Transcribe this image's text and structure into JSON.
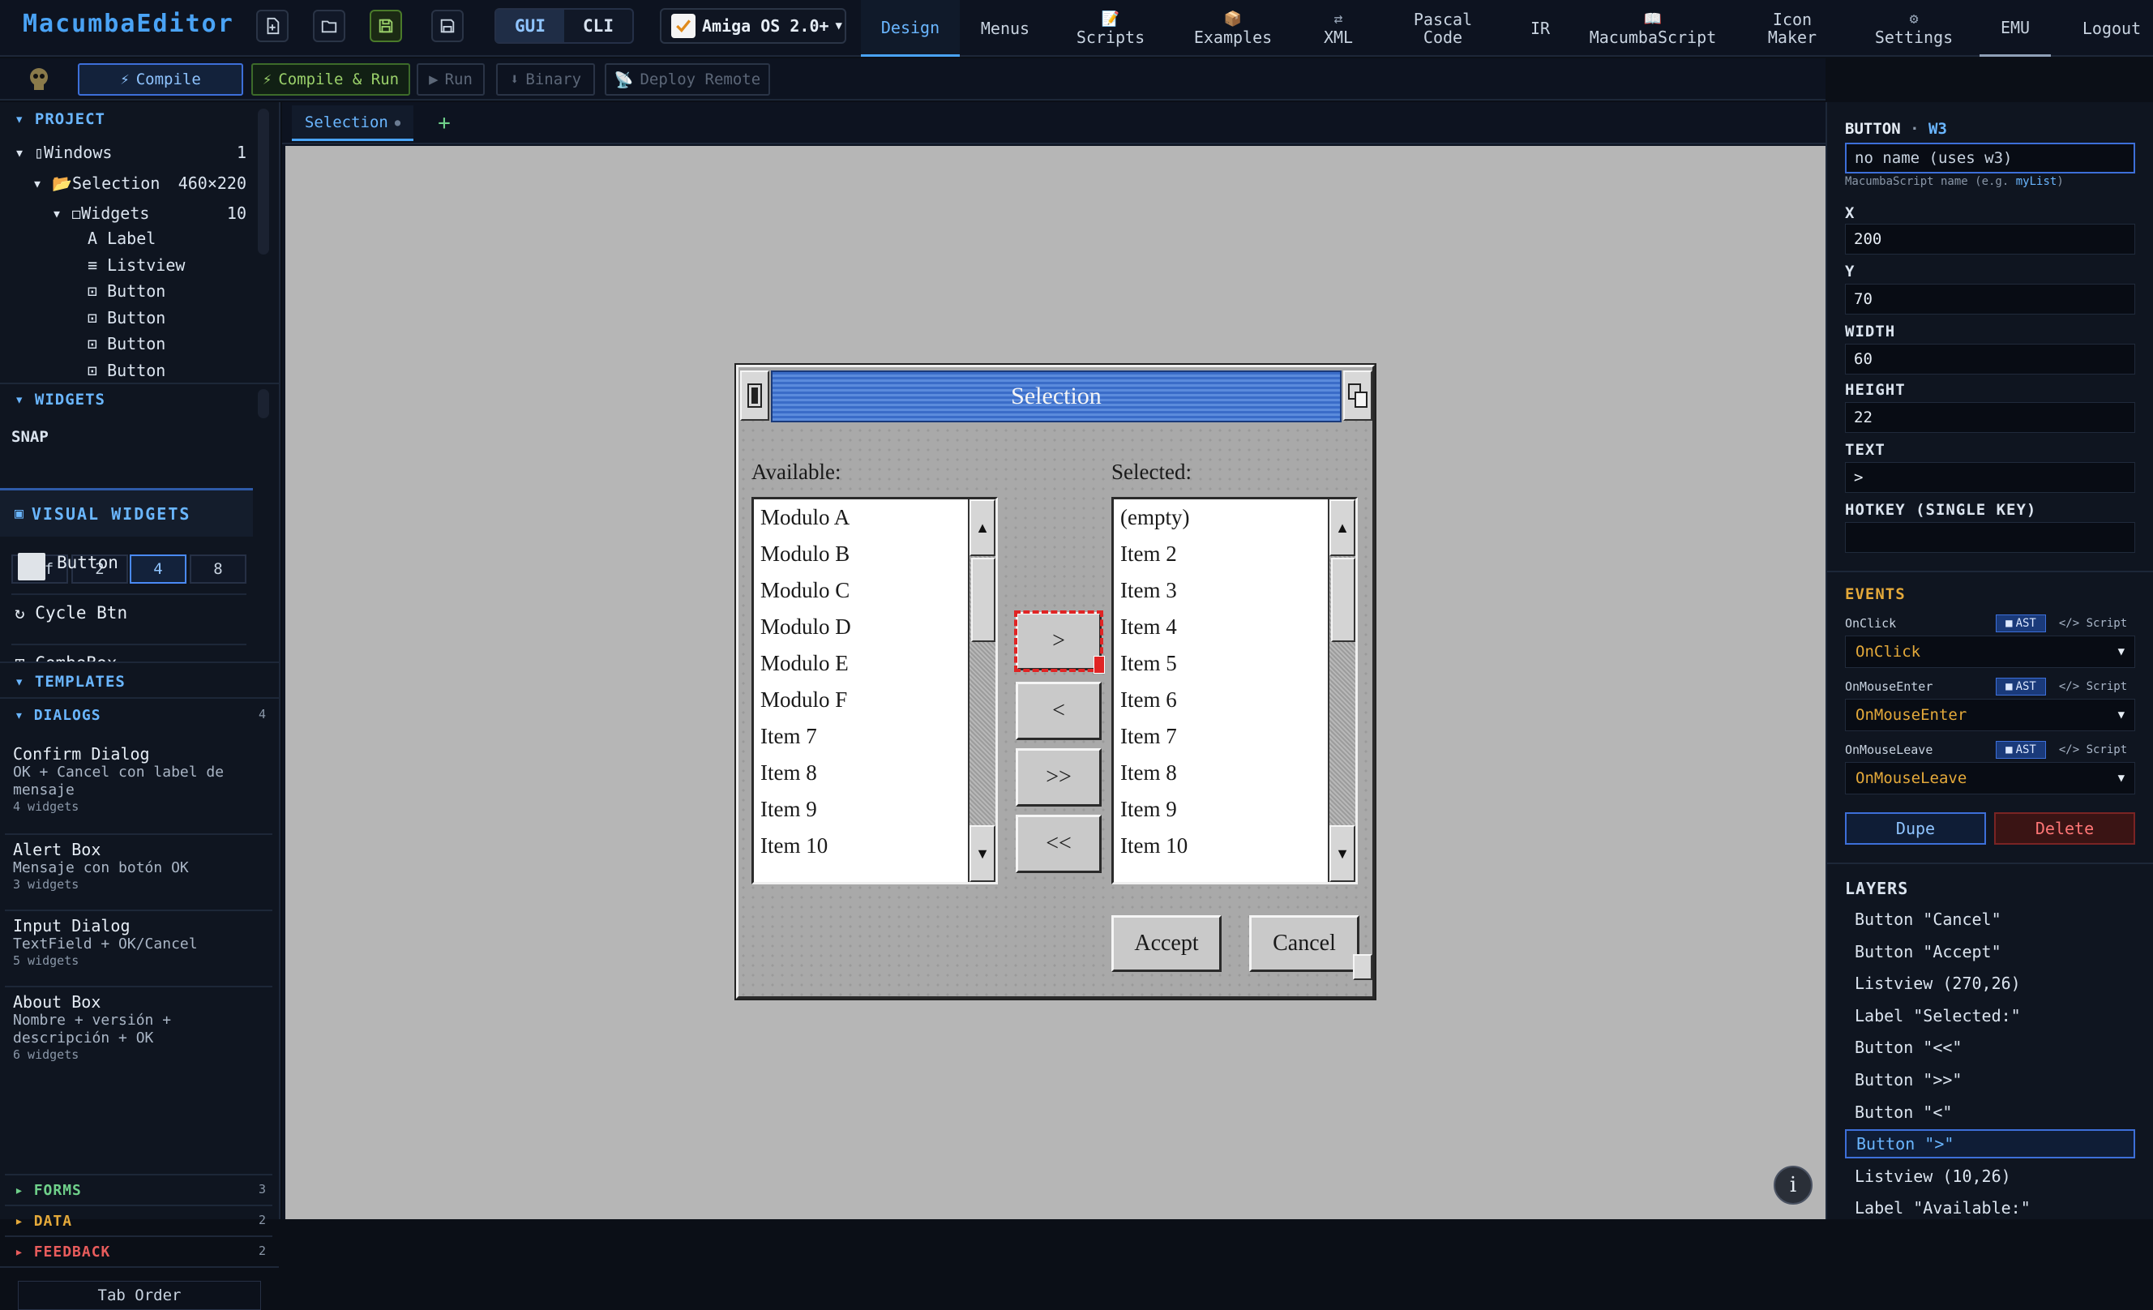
{
  "app": {
    "logo": "MacumbaEditor"
  },
  "mode": {
    "gui": "GUI",
    "cli": "CLI"
  },
  "os_select": {
    "value": "Amiga OS 2.0+"
  },
  "nav": {
    "design": "Design",
    "menus": "Menus",
    "scripts": "Scripts",
    "examples": "Examples",
    "xml": "XML",
    "pascal1": "Pascal",
    "pascal2": "Code",
    "ir": "IR",
    "macumbascript": "MacumbaScript",
    "icon1": "Icon",
    "icon2": "Maker",
    "settings": "Settings",
    "emu": "EMU",
    "logout": "Logout"
  },
  "toolbar": {
    "compile": "Compile",
    "compile_run": "Compile & Run",
    "run": "Run",
    "binary": "Binary",
    "deploy": "Deploy Remote"
  },
  "project": {
    "header": "PROJECT",
    "windows": "Windows",
    "windows_count": "1",
    "selection": "Selection",
    "selection_size": "460×220",
    "widgets": "Widgets",
    "widgets_count": "10",
    "items": [
      "Label",
      "Listview",
      "Button",
      "Button",
      "Button",
      "Button"
    ]
  },
  "widgets_section": {
    "header": "WIDGETS"
  },
  "snap": {
    "label": "SNAP",
    "options": [
      "off",
      "2",
      "4",
      "8"
    ],
    "selected": "4"
  },
  "visual_widgets": {
    "header": "VISUAL WIDGETS",
    "items": [
      "Button",
      "Cycle Btn",
      "ComboBox"
    ]
  },
  "templates": {
    "header": "TEMPLATES",
    "dialogs": {
      "label": "DIALOGS",
      "count": "4"
    },
    "items": [
      {
        "name": "Confirm Dialog",
        "desc1": "OK + Cancel con label de",
        "desc2": "mensaje",
        "count": "4 widgets"
      },
      {
        "name": "Alert Box",
        "desc1": "Mensaje con botón OK",
        "desc2": "",
        "count": "3 widgets"
      },
      {
        "name": "Input Dialog",
        "desc1": "TextField + OK/Cancel",
        "desc2": "",
        "count": "5 widgets"
      },
      {
        "name": "About Box",
        "desc1": "Nombre + versión +",
        "desc2": "descripción + OK",
        "count": "6 widgets"
      }
    ],
    "forms": {
      "label": "FORMS",
      "count": "3"
    },
    "data": {
      "label": "DATA",
      "count": "2"
    },
    "feedback": {
      "label": "FEEDBACK",
      "count": "2"
    },
    "tab_order": "Tab Order"
  },
  "doc_tab": {
    "label": "Selection"
  },
  "amiga_window": {
    "title": "Selection",
    "available_label": "Available:",
    "selected_label": "Selected:",
    "available_items": [
      "Modulo A",
      "Modulo B",
      "Modulo C",
      "Modulo D",
      "Modulo E",
      "Modulo F",
      "Item 7",
      "Item 8",
      "Item 9",
      "Item 10"
    ],
    "selected_items": [
      "(empty)",
      "Item 2",
      "Item 3",
      "Item 4",
      "Item 5",
      "Item 6",
      "Item 7",
      "Item 8",
      "Item 9",
      "Item 10"
    ],
    "btn_add": ">",
    "btn_remove": "<",
    "btn_add_all": ">>",
    "btn_remove_all": "<<",
    "accept": "Accept",
    "cancel": "Cancel"
  },
  "properties": {
    "title": "BUTTON",
    "sep": "·",
    "id": "W3",
    "name_placeholder": "no name (uses w3)",
    "name_hint": "MacumbaScript name (e.g.",
    "name_hint_example": "myList",
    "name_hint_end": ")",
    "x_label": "X",
    "x": "200",
    "y_label": "Y",
    "y": "70",
    "width_label": "WIDTH",
    "width": "60",
    "height_label": "HEIGHT",
    "height": "22",
    "text_label": "TEXT",
    "text": ">",
    "hotkey_label": "HOTKEY (SINGLE KEY)",
    "hotkey": ""
  },
  "events": {
    "header": "EVENTS",
    "ast": "AST",
    "script": "Script",
    "items": [
      {
        "label": "OnClick",
        "value": "OnClick"
      },
      {
        "label": "OnMouseEnter",
        "value": "OnMouseEnter"
      },
      {
        "label": "OnMouseLeave",
        "value": "OnMouseLeave"
      }
    ],
    "dupe": "Dupe",
    "delete": "Delete"
  },
  "layers": {
    "header": "LAYERS",
    "items": [
      "Button \"Cancel\"",
      "Button \"Accept\"",
      "Listview (270,26)",
      "Label \"Selected:\"",
      "Button \"<<\"",
      "Button \">>\"",
      "Button \"<\"",
      "Button \">\"",
      "Listview (10,26)",
      "Label \"Available:\""
    ],
    "selected": "Button \">\""
  },
  "colors": {
    "accent": "#4aa3f5",
    "warning": "#e4a93a",
    "danger": "#e85c5c",
    "amiga_title": "#4a7bd3"
  }
}
